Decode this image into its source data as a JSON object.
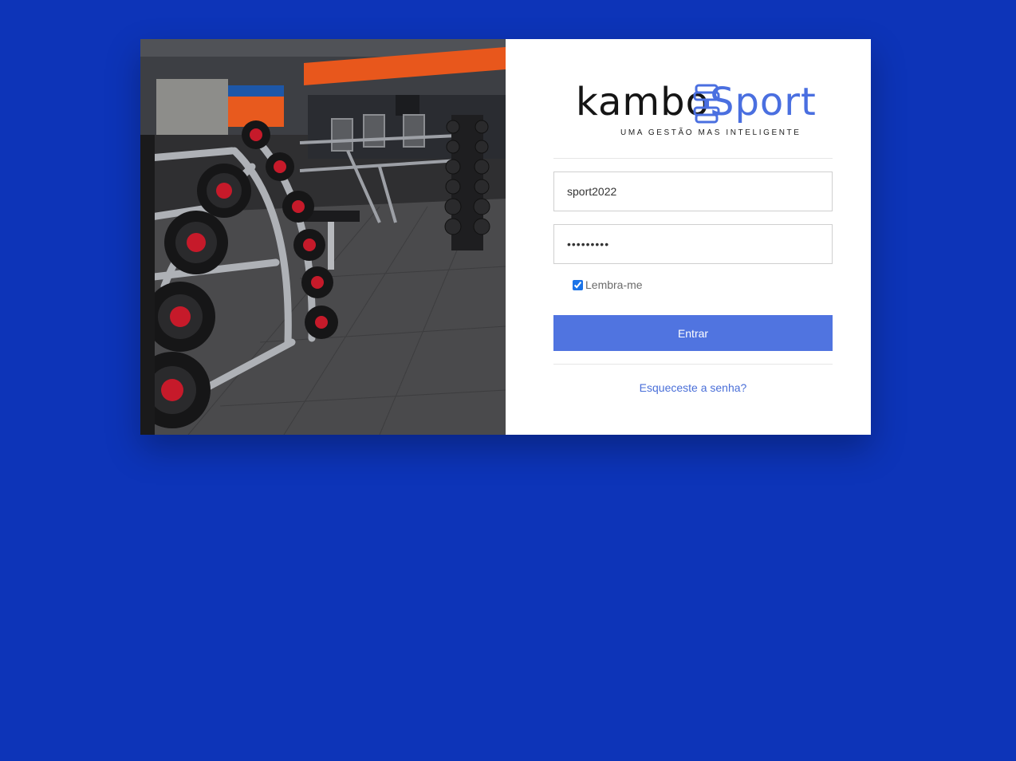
{
  "colors": {
    "page_background": "#0d34b8",
    "brand_blue": "#4a6fe0",
    "button_background": "#5074e0",
    "link_color": "#4a6fd8"
  },
  "hero_image": {
    "description_icon": "gym-dumbbell-rack-photo"
  },
  "logo": {
    "word_dark": "kambo",
    "word_brand": "Sport",
    "tagline": "UMA GESTÃO MAS INTELIGENTE",
    "icon": "dumbbell-icon"
  },
  "form": {
    "username_value": "sport2022",
    "password_value": "•••••••••",
    "remember_label": "Lembra-me",
    "remember_checked": true,
    "submit_label": "Entrar",
    "forgot_link": "Esqueceste a senha?"
  }
}
